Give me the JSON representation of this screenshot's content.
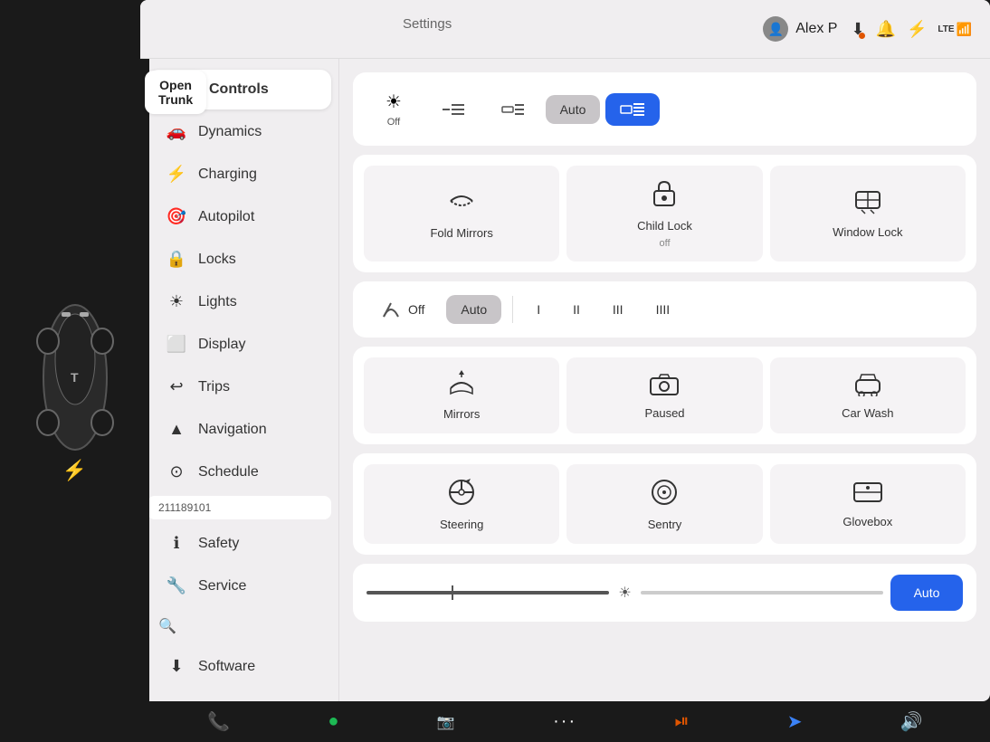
{
  "header": {
    "settings_label": "Settings",
    "user_name": "Alex P",
    "user_icon": "👤"
  },
  "open_trunk": {
    "line1": "Open",
    "line2": "Trunk"
  },
  "sidebar": {
    "items": [
      {
        "id": "controls",
        "label": "Controls",
        "icon": "toggle",
        "active": true
      },
      {
        "id": "dynamics",
        "label": "Dynamics",
        "icon": "car"
      },
      {
        "id": "charging",
        "label": "Charging",
        "icon": "bolt"
      },
      {
        "id": "autopilot",
        "label": "Autopilot",
        "icon": "steering"
      },
      {
        "id": "locks",
        "label": "Locks",
        "icon": "lock"
      },
      {
        "id": "lights",
        "label": "Lights",
        "icon": "sun"
      },
      {
        "id": "display",
        "label": "Display",
        "icon": "display"
      },
      {
        "id": "trips",
        "label": "Trips",
        "icon": "trips"
      },
      {
        "id": "navigation",
        "label": "Navigation",
        "icon": "nav"
      },
      {
        "id": "schedule",
        "label": "Schedule",
        "icon": "schedule"
      },
      {
        "id": "safety",
        "label": "Safety",
        "icon": "safety"
      },
      {
        "id": "service",
        "label": "Service",
        "icon": "service"
      },
      {
        "id": "software",
        "label": "Software",
        "icon": "download"
      }
    ],
    "phone_id": "211189101",
    "search_icon": "🔍"
  },
  "controls": {
    "light_row": {
      "btn_off": "Off",
      "btn_drl": "",
      "btn_side": "",
      "btn_auto": "Auto",
      "btn_full": ""
    },
    "mirror_child_lock_row": {
      "fold_mirrors_label": "Fold Mirrors",
      "child_lock_label": "Child Lock",
      "child_lock_status": "off",
      "window_lock_label": "Window Lock"
    },
    "wipers_row": {
      "btn_off": "Off",
      "btn_auto": "Auto",
      "speed1": "I",
      "speed2": "II",
      "speed3": "III",
      "speed4": "IIII"
    },
    "action_row1": {
      "mirrors_label": "Mirrors",
      "paused_label": "Paused",
      "car_wash_label": "Car Wash"
    },
    "action_row2": {
      "steering_label": "Steering",
      "sentry_label": "Sentry",
      "glovebox_label": "Glovebox"
    },
    "brightness_row": {
      "auto_label": "Auto"
    }
  },
  "taskbar": {
    "phone_icon": "📞",
    "spotify_icon": "🎵",
    "camera_icon": "📷",
    "more_icon": "···",
    "joystick_icon": "🕹",
    "nav_icon": "➤",
    "volume_icon": "🔊"
  }
}
